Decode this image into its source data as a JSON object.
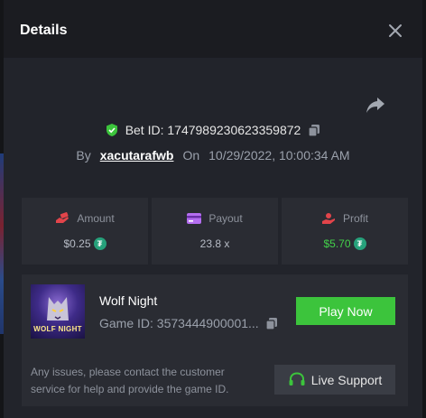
{
  "modal": {
    "title": "Details"
  },
  "bet": {
    "id_label": "Bet ID: 1747989230623359872",
    "by_label": "By",
    "username": "xacutarafwb",
    "on_label": "On",
    "datetime": "10/29/2022, 10:00:34 AM"
  },
  "stats": [
    {
      "label": "Amount",
      "value": "$0.25",
      "icon": "amount-hand-icon"
    },
    {
      "label": "Payout",
      "value": "23.8 x",
      "icon": "payout-card-icon"
    },
    {
      "label": "Profit",
      "value": "$5.70",
      "icon": "profit-hand-icon"
    }
  ],
  "currency_icon": "tether-icon",
  "game": {
    "thumb_text": "WOLF NIGHT",
    "name": "Wolf Night",
    "id_label": "Game ID: 3573444900001...",
    "play_label": "Play Now"
  },
  "support": {
    "note": "Any issues, please contact the customer service for help and provide the game ID.",
    "button_label": "Live Support"
  },
  "colors": {
    "accent_green": "#3cc43c",
    "profit_green": "#43d14a",
    "background": "#22242b"
  }
}
